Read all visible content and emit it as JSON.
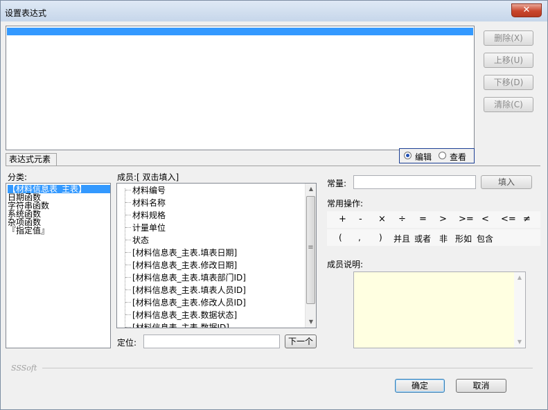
{
  "window": {
    "title": "设置表达式",
    "close_glyph": "✕"
  },
  "expression": {
    "buttons": [
      "删除(X)",
      "上移(U)",
      "下移(D)",
      "清除(C)"
    ]
  },
  "mode": {
    "options": [
      "编辑",
      "查看"
    ],
    "selected": "编辑"
  },
  "tab": {
    "label": "表达式元素"
  },
  "categories": {
    "label": "分类:",
    "items": [
      "【材料信息表_主表】",
      "日期函数",
      "字符串函数",
      "系统函数",
      "杂项函数",
      "『指定值』"
    ],
    "selected_index": 0
  },
  "members": {
    "label": "成员:[ 双击填入]",
    "items": [
      "材料编号",
      "材料名称",
      "材料规格",
      "计量单位",
      "状态",
      "[材料信息表_主表.填表日期]",
      "[材料信息表_主表.修改日期]",
      "[材料信息表_主表.填表部门ID]",
      "[材料信息表_主表.填表人员ID]",
      "[材料信息表_主表.修改人员ID]",
      "[材料信息表_主表.数据状态]",
      "[材料信息表_主表.数据ID]"
    ]
  },
  "locate": {
    "label": "定位:",
    "value": "",
    "next_button": "下一个"
  },
  "constant": {
    "label": "常量:",
    "value": "",
    "fill_button": "填入"
  },
  "operations": {
    "label": "常用操作:",
    "row1": [
      "+",
      "-",
      "×",
      "÷",
      "=",
      ">",
      ">=",
      "<",
      "<=",
      "≠"
    ],
    "row2": [
      "(",
      ",",
      ")",
      "并且",
      "或者",
      "非",
      "形如",
      "包含"
    ]
  },
  "member_description": {
    "label": "成员说明:",
    "value": ""
  },
  "footer": {
    "brand": "SSSoft",
    "ok_button": "确定",
    "cancel_button": "取消"
  },
  "icons": {
    "scroll_up": "▲",
    "scroll_down": "▼",
    "grip": "≡"
  }
}
